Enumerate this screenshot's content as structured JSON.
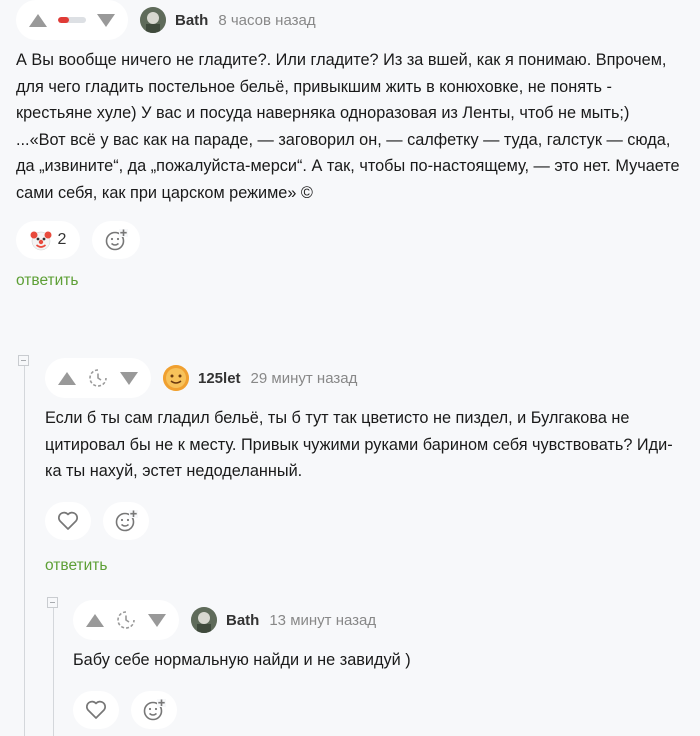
{
  "comments": [
    {
      "author": "Bath",
      "time": "8 часов назад",
      "rating_fraction": 0.4,
      "paragraphs": [
        "А Вы вообще ничего не гладите?. Или гладите? Из за вшей, как я понимаю. Впрочем, для чего гладить постельное бельё, привыкшим жить в конюховке, не понять - крестьяне хуле) У вас и посуда наверняка одноразовая из Ленты, чтоб не мыть;)",
        "...«Вот всё у вас как на параде, — заговорил он, — салфетку — туда, галстук — сюда, да „извините“, да „пожалуйста-мерси“. А так, чтобы по-настоящему, — это нет. Мучаете сами себя, как при царском режиме» ©"
      ],
      "reaction": {
        "icon": "clown-face-icon",
        "count": "2"
      },
      "add_reaction_icon": "add-reaction-icon",
      "reply_label": "ответить"
    },
    {
      "author": "125let",
      "time": "29 минут назад",
      "paragraphs": [
        "Если б ты сам гладил бельё, ты б тут так цветисто не пиздел, и Булгакова не цитировал бы не к месту. Привык чужими руками барином себя чувствовать? Иди-ка ты нахуй, эстет недоделанный."
      ],
      "reply_label": "ответить"
    },
    {
      "author": "Bath",
      "time": "13 минут назад",
      "paragraphs": [
        "Бабу себе нормальную найди и не завидуй )"
      ]
    }
  ],
  "colors": {
    "accent_reply": "#5d9f35",
    "rating_negative": "#e03b36",
    "icon_gray": "#999999"
  }
}
